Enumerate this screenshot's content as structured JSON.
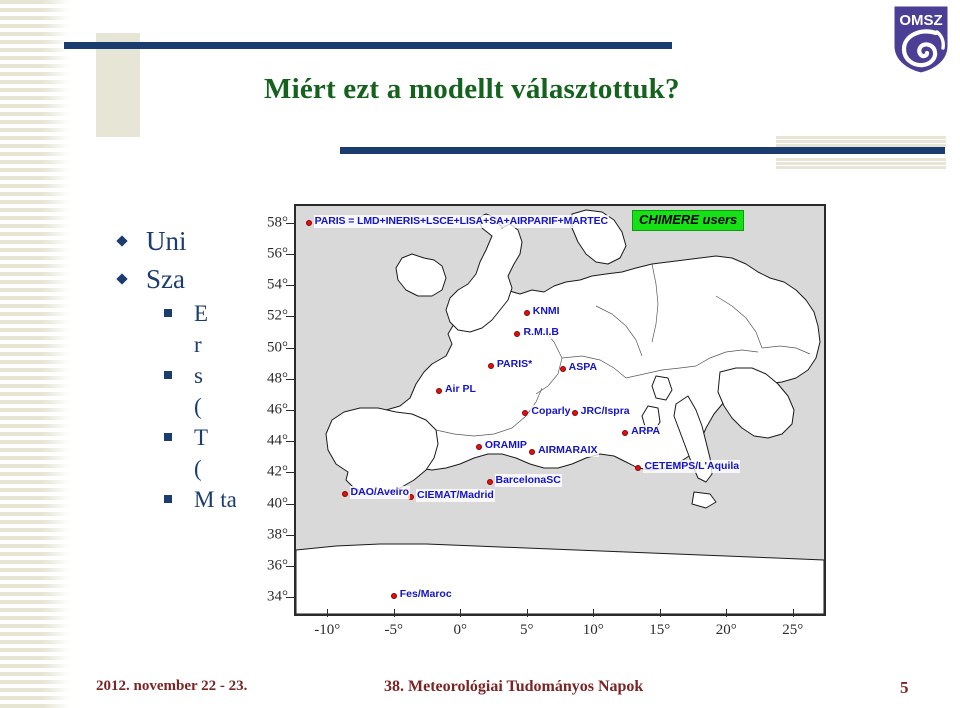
{
  "slide": {
    "title": "Miért ezt a modellt választottuk?",
    "page_number": "5"
  },
  "body": {
    "items": [
      {
        "level": 1,
        "text": "Uni"
      },
      {
        "level": 1,
        "text": "Sza"
      },
      {
        "level": 2,
        "text": "E"
      },
      {
        "level": 2,
        "text": "r",
        "continuation": true
      },
      {
        "level": 2,
        "text": "s"
      },
      {
        "level": 2,
        "text": "(",
        "continuation": true
      },
      {
        "level": 2,
        "text": "T"
      },
      {
        "level": 2,
        "text": "(",
        "continuation": true
      },
      {
        "level": 2,
        "text": "M                                                                                                                ta"
      }
    ]
  },
  "footer": {
    "date": "2012. november 22 - 23.",
    "event": "38. Meteorológiai Tudományos Napok"
  },
  "logo": {
    "text": "OMSZ",
    "shield_color": "#4a3f95",
    "alt": "OMSZ shield logo"
  },
  "colors": {
    "title_green": "#14621d",
    "navy": "#1b3c6e",
    "beige": "#e7e6d6",
    "footer_red": "#7a2424",
    "marker_red": "#e01010",
    "label_blue": "#1414c8",
    "badge_green": "#16e016"
  },
  "chart_data": {
    "type": "scatter",
    "title": "CHIMERE users",
    "badge_label": "CHIMERE users",
    "header_note": "PARIS = LMD+INERIS+LSCE+LISA+SA+AIRPARIF+MARTEC",
    "xlabel": "",
    "ylabel": "",
    "xlim": [
      -12.5,
      27.5
    ],
    "ylim": [
      32.8,
      59.2
    ],
    "grid": false,
    "legend_position": "top-right",
    "xticks": [
      "-10°",
      "-5°",
      "0°",
      "5°",
      "10°",
      "15°",
      "20°",
      "25°"
    ],
    "xtick_values": [
      -10,
      -5,
      0,
      5,
      10,
      15,
      20,
      25
    ],
    "yticks": [
      "58°",
      "56°",
      "54°",
      "52°",
      "50°",
      "48°",
      "46°",
      "44°",
      "42°",
      "40°",
      "38°",
      "36°",
      "34°"
    ],
    "ytick_values": [
      58,
      56,
      54,
      52,
      50,
      48,
      46,
      44,
      42,
      40,
      38,
      36,
      34
    ],
    "points": [
      {
        "label": "PARIS = LMD+INERIS+LSCE+LISA+SA+AIRPARIF+MARTEC",
        "x": -11.4,
        "y": 58.0,
        "header": true
      },
      {
        "label": "KNMI",
        "x": 5.0,
        "y": 52.2
      },
      {
        "label": "R.M.I.B",
        "x": 4.3,
        "y": 50.9
      },
      {
        "label": "PARIS*",
        "x": 2.3,
        "y": 48.8
      },
      {
        "label": "ASPA",
        "x": 7.7,
        "y": 48.6
      },
      {
        "label": "Air PL",
        "x": -1.6,
        "y": 47.2
      },
      {
        "label": "Coparly",
        "x": 4.9,
        "y": 45.8
      },
      {
        "label": "JRC/Ispra",
        "x": 8.6,
        "y": 45.8
      },
      {
        "label": "ARPA",
        "x": 12.4,
        "y": 44.5
      },
      {
        "label": "ORAMIP",
        "x": 1.4,
        "y": 43.6
      },
      {
        "label": "AIRMARAIX",
        "x": 5.4,
        "y": 43.3
      },
      {
        "label": "CETEMPS/L'Aquila",
        "x": 13.4,
        "y": 42.3
      },
      {
        "label": "BarcelonaSC",
        "x": 2.2,
        "y": 41.4
      },
      {
        "label": "CIEMAT/Madrid",
        "x": -3.7,
        "y": 40.4
      },
      {
        "label": "DAO/Aveiro",
        "x": -8.7,
        "y": 40.6
      },
      {
        "label": "Fes/Maroc",
        "x": -5.0,
        "y": 34.1
      }
    ]
  }
}
